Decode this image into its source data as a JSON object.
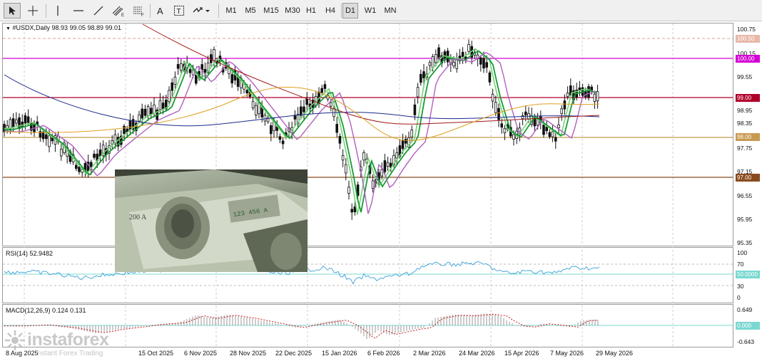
{
  "toolbar": {
    "timeframes": [
      "M1",
      "M5",
      "M15",
      "M30",
      "H1",
      "H4",
      "D1",
      "W1",
      "MN"
    ],
    "active_timeframe": "D1"
  },
  "chart": {
    "symbol_line": "#USDX,Daily  98.93 99.05 98.89 99.01",
    "price_axis": [
      "100.75",
      "100.15",
      "99.55",
      "98.95",
      "98.35",
      "97.75",
      "97.15",
      "96.55",
      "95.95",
      "95.35"
    ],
    "price_labels": {
      "p10050": "100.50",
      "p10000": "100.00",
      "p9900": "99.00",
      "p9800": "98.00",
      "p9700": "97.00"
    },
    "date_axis": [
      "8 Aug 2025",
      "15 Oct 2025",
      "6 Nov 2025",
      "28 Nov 2025",
      "22 Dec 2025",
      "15 Jan 2026",
      "6 Feb 2026",
      "2 Mar 2026",
      "24 Mar 2026",
      "15 Apr 2026",
      "7 May 2026",
      "29 May 2026"
    ]
  },
  "rsi": {
    "title": "RSI(14) 52.9482",
    "axis": [
      "100",
      "70",
      "50",
      "30",
      "0"
    ],
    "level_label": "50.0000"
  },
  "macd": {
    "title": "MACD(12,26,9) 0.124 0.131",
    "axis": [
      "0.649",
      "-0.643"
    ],
    "zero_label": "0.000"
  },
  "watermark": {
    "brand": "instaforex",
    "tagline": "Instant Forex Trading"
  },
  "colors": {
    "magenta_level": "#d400d4",
    "red_level": "#b0002a",
    "orange_level": "#c89a50",
    "brown_level": "#8a4a1c",
    "ema_green": "#1a9a3a",
    "ema_lime": "#74d474",
    "ema_purple": "#b060c0",
    "ma_navy": "#1a2a8a",
    "ma_dark_red": "#a01818",
    "ma_orange": "#e0a020",
    "rsi_line": "#3aa0d8",
    "macd_hist": "#9a9a9a",
    "macd_signal": "#c81818"
  }
}
